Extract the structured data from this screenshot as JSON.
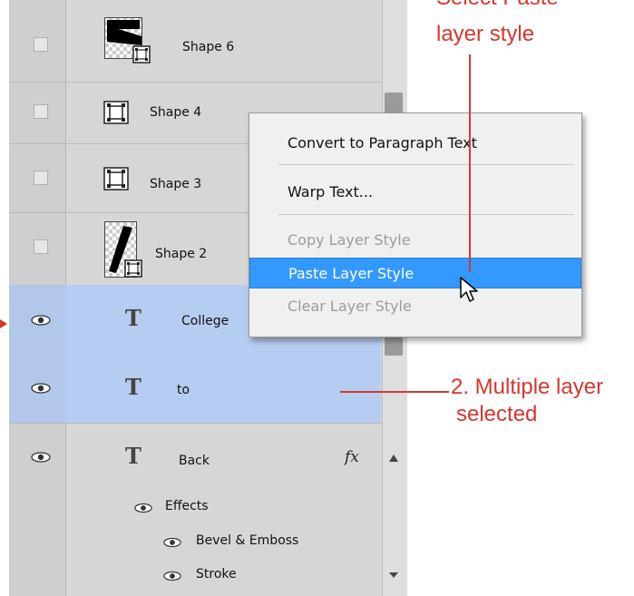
{
  "layers": [
    {
      "name": "Shape 6",
      "visible": false,
      "kind": "shape"
    },
    {
      "name": "Shape 4",
      "visible": false,
      "kind": "shape"
    },
    {
      "name": "Shape 3",
      "visible": false,
      "kind": "shape"
    },
    {
      "name": "Shape 2",
      "visible": false,
      "kind": "shape"
    },
    {
      "name": "College",
      "visible": true,
      "kind": "text",
      "selected": true
    },
    {
      "name": "to",
      "visible": true,
      "kind": "text",
      "selected": true
    },
    {
      "name": "Back",
      "visible": true,
      "kind": "text",
      "fx": "fx"
    }
  ],
  "effects": {
    "header": "Effects",
    "items": [
      "Bevel & Emboss",
      "Stroke"
    ]
  },
  "context_menu": {
    "items": [
      {
        "label": "Convert to Paragraph Text",
        "enabled": true
      },
      {
        "label": "Warp Text...",
        "enabled": true
      },
      {
        "label": "Copy Layer Style",
        "enabled": false
      },
      {
        "label": "Paste Layer Style",
        "enabled": true,
        "highlighted": true
      },
      {
        "label": "Clear Layer Style",
        "enabled": false
      }
    ]
  },
  "annotations": {
    "top_line1": "Select Paste",
    "top_line2": "layer style",
    "right_line1": "2. Multiple layer",
    "right_line2": "selected"
  },
  "colors": {
    "selection": "#b5cdf0",
    "menu_highlight": "#3399ff",
    "annotation": "#d7352d"
  }
}
